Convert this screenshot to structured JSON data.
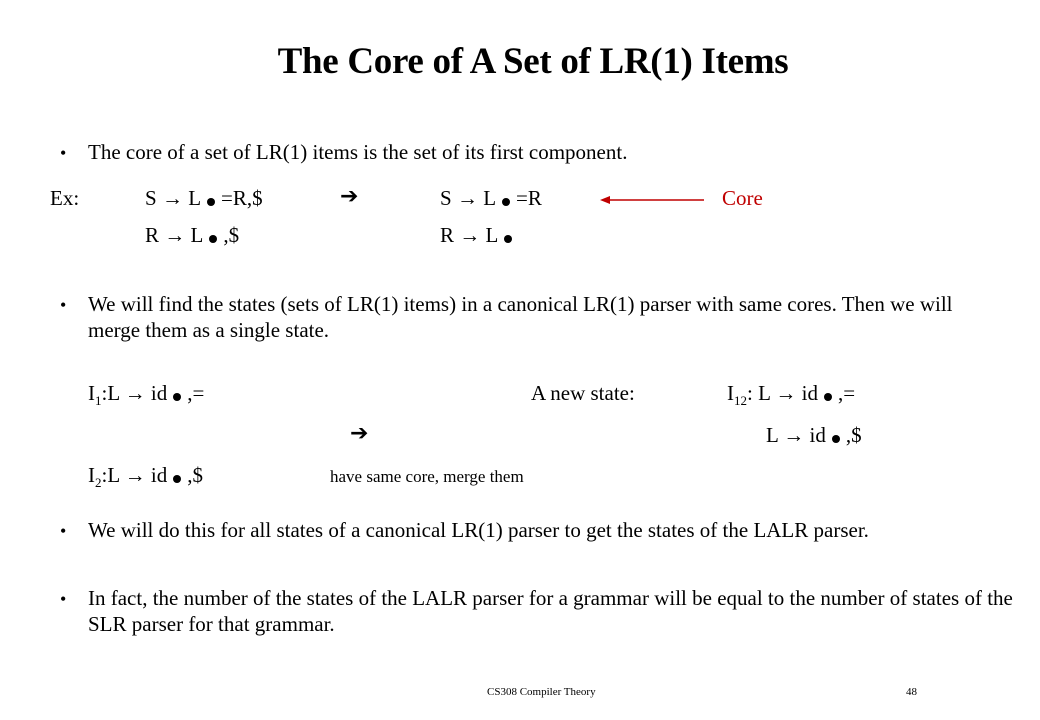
{
  "slide": {
    "title": "The Core of A Set of LR(1) Items",
    "bullet_glyph": "•",
    "bullet1": "The core of  a set of LR(1) items is the set of its first component.",
    "example": {
      "label": "Ex:",
      "left_items": [
        {
          "lhs": "S",
          "arrow": "→",
          "before_dot": "L",
          "after_dot": "=R,$"
        },
        {
          "lhs": "R",
          "arrow": "→",
          "before_dot": "L",
          "after_dot": ",$"
        }
      ],
      "implies_arrow": "➔",
      "right_items": [
        {
          "lhs": "S",
          "arrow": "→",
          "before_dot": "L",
          "after_dot": "=R"
        },
        {
          "lhs": "R",
          "arrow": "→",
          "before_dot": "L",
          "after_dot": ""
        }
      ],
      "core_label": "Core",
      "core_color": "#c00000"
    },
    "bullet2": "We will find the states (sets of LR(1) items) in a canonical LR(1) parser with same cores. Then we will merge them as a single state.",
    "merge_example": {
      "state1": {
        "name": "I",
        "sub": "1",
        "item": ":L → id",
        "after_dot": ",="
      },
      "state2": {
        "name": "I",
        "sub": "2",
        "item": ":L → id",
        "after_dot": ",$"
      },
      "implies_arrow": "➔",
      "new_state_label": "A new state:",
      "new_state": {
        "name": "I",
        "sub": "12",
        "item1": ": L → id",
        "after_dot1": ",=",
        "item2": "L → id",
        "after_dot2": ",$"
      },
      "note": "have same core, merge them"
    },
    "bullet3": "We will do this for all states of a canonical LR(1) parser to get the states of the LALR parser.",
    "bullet4": "In fact, the number of the states of the LALR parser for a grammar will be equal to the number of states of the SLR parser for that grammar."
  },
  "footer": {
    "course": "CS308 Compiler Theory",
    "page_number": "48"
  }
}
